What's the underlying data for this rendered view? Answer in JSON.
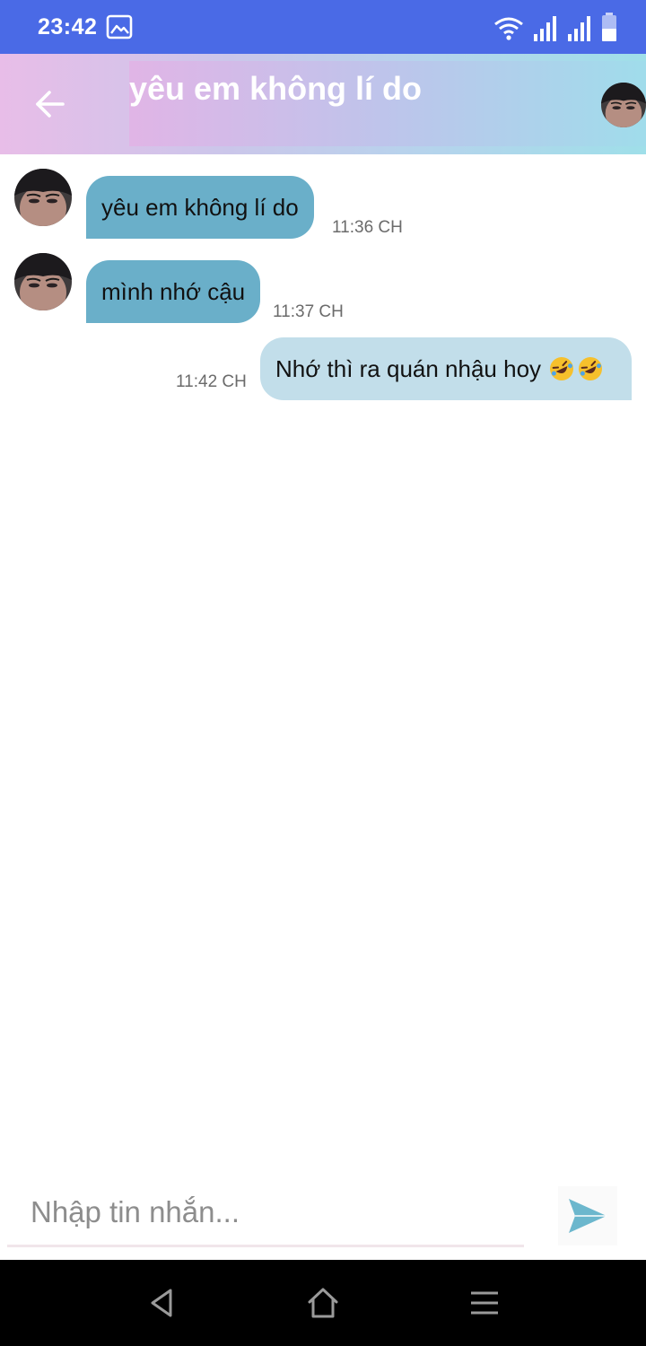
{
  "status_bar": {
    "time": "23:42",
    "icons": [
      "gallery-icon",
      "wifi-icon",
      "signal-icon",
      "signal-icon",
      "battery-icon"
    ]
  },
  "header": {
    "title": "yêu em không lí do",
    "back_icon": "arrow-left-icon",
    "avatar": "contact-avatar"
  },
  "messages": [
    {
      "direction": "incoming",
      "text": "yêu em không lí do",
      "time": "11:36 CH"
    },
    {
      "direction": "incoming",
      "text": "mình nhớ cậu",
      "time": "11:37 CH"
    },
    {
      "direction": "outgoing",
      "text": "Nhớ thì ra quán nhậu hoy",
      "emoji": "rolling-on-floor-laughing x2",
      "time": "11:42 CH"
    }
  ],
  "composer": {
    "placeholder": "Nhập tin nhắn...",
    "value": "",
    "send_icon": "send-icon"
  },
  "nav_bar": {
    "icons": [
      "back-triangle-icon",
      "home-icon",
      "menu-icon"
    ]
  },
  "colors": {
    "status_bar": "#4a6ae6",
    "incoming_bubble": "#6aafc9",
    "outgoing_bubble": "#c2deea",
    "send_accent": "#6cb7cd"
  }
}
